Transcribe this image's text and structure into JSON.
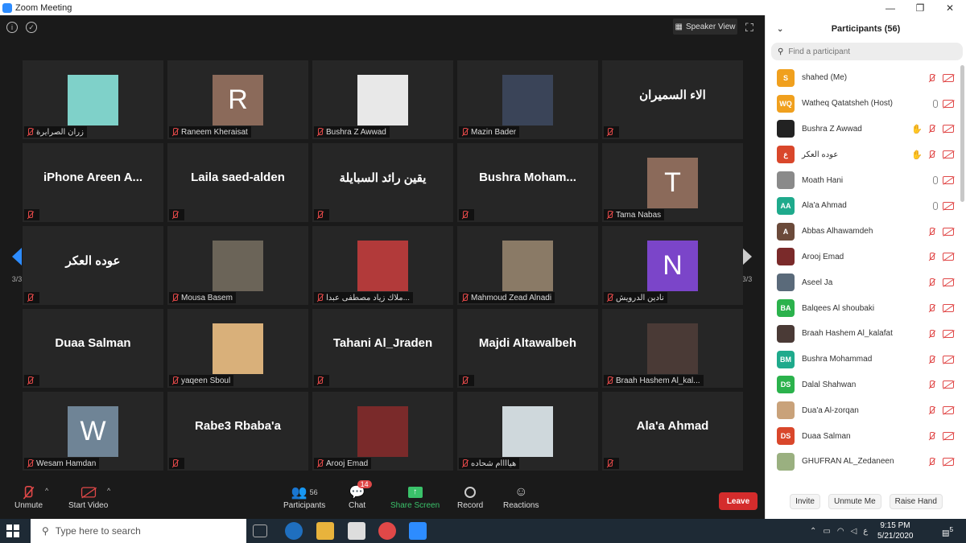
{
  "window": {
    "title": "Zoom Meeting",
    "controls": [
      "—",
      "❐",
      "✕"
    ]
  },
  "stage": {
    "speaker_view_label": "Speaker View",
    "page_left": "3/3",
    "page_right": "3/3",
    "tiles": [
      {
        "name": "زران الصرايرة",
        "kind": "photo",
        "photo_color": "#7fd1c9"
      },
      {
        "name": "Raneem Kheraisat",
        "kind": "letter",
        "letter": "R",
        "letter_color": "#8b6a5a"
      },
      {
        "name": "Bushra Z Awwad",
        "kind": "photo",
        "photo_color": "#e8e8e8"
      },
      {
        "name": "Mazin Bader",
        "kind": "photo",
        "photo_color": "#3a4458"
      },
      {
        "name": "",
        "kind": "bigname",
        "big": "الاء السميران"
      },
      {
        "name": "",
        "kind": "bigname",
        "big": "iPhone Areen A..."
      },
      {
        "name": "",
        "kind": "bigname",
        "big": "Laila saed-alden"
      },
      {
        "name": "",
        "kind": "bigname",
        "big": "يقين رائد السبايلة"
      },
      {
        "name": "",
        "kind": "bigname",
        "big": "Bushra  Moham..."
      },
      {
        "name": "Tama Nabas",
        "kind": "letter",
        "letter": "T",
        "letter_color": "#8b6a5a"
      },
      {
        "name": "",
        "kind": "bigname",
        "big": "عوده العكر"
      },
      {
        "name": "Mousa Basem",
        "kind": "photo",
        "photo_color": "#6b6458"
      },
      {
        "name": "ملاك زياد مصطفى عبدا...",
        "kind": "photo",
        "photo_color": "#b23a3a"
      },
      {
        "name": "Mahmoud Zead Alnadi",
        "kind": "photo",
        "photo_color": "#8a7a66"
      },
      {
        "name": "نادين الدرويش",
        "kind": "letter",
        "letter": "N",
        "letter_color": "#7b45c9"
      },
      {
        "name": "",
        "kind": "bigname",
        "big": "Duaa Salman"
      },
      {
        "name": "yaqeen Sboul",
        "kind": "photo",
        "photo_color": "#d9b07a"
      },
      {
        "name": "",
        "kind": "bigname",
        "big": "Tahani Al_Jraden"
      },
      {
        "name": "",
        "kind": "bigname",
        "big": "Majdi Altawalbeh"
      },
      {
        "name": "Braah Hashem Al_kal...",
        "kind": "photo",
        "photo_color": "#4a3a36"
      },
      {
        "name": "Wesam Hamdan",
        "kind": "letter",
        "letter": "W",
        "letter_color": "#6f8496"
      },
      {
        "name": "",
        "kind": "bigname",
        "big": "Rabe3 Rbaba'a"
      },
      {
        "name": "Arooj Emad",
        "kind": "photo",
        "photo_color": "#7a2a2a"
      },
      {
        "name": "هياااام شحاده",
        "kind": "photo",
        "photo_color": "#cfd8dc"
      },
      {
        "name": "",
        "kind": "bigname",
        "big": "Ala'a Ahmad"
      }
    ]
  },
  "toolbar": {
    "unmute": "Unmute",
    "start_video": "Start Video",
    "participants": "Participants",
    "participants_count": "56",
    "chat": "Chat",
    "chat_badge": "14",
    "share_screen": "Share Screen",
    "record": "Record",
    "reactions": "Reactions",
    "leave": "Leave"
  },
  "panel": {
    "title": "Participants (56)",
    "search_placeholder": "Find a participant",
    "participants": [
      {
        "name": "shahed (Me)",
        "initials": "S",
        "color": "#f0a01e",
        "mic": "off",
        "hand": false
      },
      {
        "name": "Watheq Qatatsheh (Host)",
        "initials": "WQ",
        "color": "#f0a01e",
        "mic": "on",
        "hand": false
      },
      {
        "name": "Bushra Z Awwad",
        "initials": "",
        "color": "#222222",
        "mic": "off",
        "hand": true
      },
      {
        "name": "عوده العكر",
        "initials": "ع",
        "color": "#d9472b",
        "mic": "off",
        "hand": true
      },
      {
        "name": "Moath Hani",
        "initials": "",
        "color": "#8a8a8a",
        "mic": "on",
        "hand": false
      },
      {
        "name": "Ala'a Ahmad",
        "initials": "AA",
        "color": "#1faa8c",
        "mic": "on",
        "hand": false
      },
      {
        "name": "Abbas Alhawamdeh",
        "initials": "A",
        "color": "#6b4a3a",
        "mic": "off",
        "hand": false
      },
      {
        "name": "Arooj Emad",
        "initials": "",
        "color": "#7a2a2a",
        "mic": "off",
        "hand": false
      },
      {
        "name": "Aseel Ja",
        "initials": "",
        "color": "#5a6a7a",
        "mic": "off",
        "hand": false
      },
      {
        "name": "Balqees Al shoubaki",
        "initials": "BA",
        "color": "#2bb24c",
        "mic": "off",
        "hand": false
      },
      {
        "name": "Braah Hashem Al_kalafat",
        "initials": "",
        "color": "#4a3a36",
        "mic": "off",
        "hand": false
      },
      {
        "name": "Bushra Mohammad",
        "initials": "BM",
        "color": "#1faa8c",
        "mic": "off",
        "hand": false
      },
      {
        "name": "Dalal Shahwan",
        "initials": "DS",
        "color": "#2bb24c",
        "mic": "off",
        "hand": false
      },
      {
        "name": "Dua'a Al-zorqan",
        "initials": "",
        "color": "#c9a27a",
        "mic": "off",
        "hand": false
      },
      {
        "name": "Duaa Salman",
        "initials": "DS",
        "color": "#d9472b",
        "mic": "off",
        "hand": false
      },
      {
        "name": "GHUFRAN AL_Zedaneen",
        "initials": "",
        "color": "#9ab080",
        "mic": "off",
        "hand": false
      }
    ],
    "footer": {
      "invite": "Invite",
      "unmute_me": "Unmute Me",
      "raise_hand": "Raise Hand"
    }
  },
  "taskbar": {
    "search_placeholder": "Type here to search",
    "time": "9:15 PM",
    "date": "5/21/2020",
    "lang": "ع",
    "notifications": "5"
  }
}
